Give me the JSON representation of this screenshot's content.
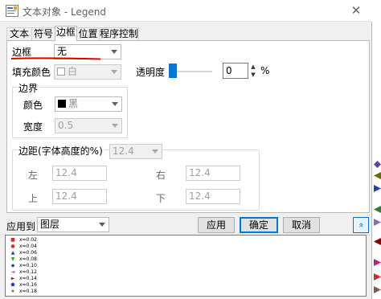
{
  "window": {
    "title": "文本对象 - Legend",
    "close_glyph": "✕"
  },
  "tabs": [
    {
      "label": "文本",
      "active": false
    },
    {
      "label": "符号",
      "active": false
    },
    {
      "label": "边框",
      "active": true
    },
    {
      "label": "位置",
      "active": false
    },
    {
      "label": "程序控制",
      "active": false
    }
  ],
  "border_tab": {
    "border_label": "边框",
    "border_value": "无",
    "fill_label": "填充颜色",
    "fill_value": "白",
    "fill_color": "#ffffff",
    "transparency_label": "透明度",
    "transparency_value": "0",
    "transparency_unit": "%",
    "transparency_level": 0,
    "edge_group": {
      "title": "边界",
      "color_label": "颜色",
      "color_value": "黑",
      "color_swatch": "#000000",
      "width_label": "宽度",
      "width_value": "0.5"
    },
    "margin_group": {
      "title": "边距(字体高度的%)",
      "all_value": "12.4",
      "left_label": "左",
      "left_value": "12.4",
      "right_label": "右",
      "right_value": "12.4",
      "top_label": "上",
      "top_value": "12.4",
      "bottom_label": "下",
      "bottom_value": "12.4"
    }
  },
  "apply_to": {
    "label": "应用到",
    "value": "图层"
  },
  "buttons": {
    "apply": "应用",
    "ok": "确定",
    "cancel": "取消",
    "expand_glyph": "»"
  },
  "preview": {
    "legend_items": [
      {
        "symbol": "■",
        "color": "#d62728",
        "label": "x=0.02"
      },
      {
        "symbol": "●",
        "color": "#d62728",
        "label": "x=0.04"
      },
      {
        "symbol": "▲",
        "color": "#1f3fbf",
        "label": "x=0.06"
      },
      {
        "symbol": "▼",
        "color": "#2ca02c",
        "label": "x=0.08"
      },
      {
        "symbol": "◆",
        "color": "#1f3fbf",
        "label": "x=0.10"
      },
      {
        "symbol": "◄",
        "color": "#9467bd",
        "label": "x=0.12"
      },
      {
        "symbol": "►",
        "color": "#8b0000",
        "label": "x=0.14"
      },
      {
        "symbol": "⬟",
        "color": "#1f3fbf",
        "label": "x=0.16"
      },
      {
        "symbol": "★",
        "color": "#6b6b00",
        "label": "x=0.18"
      }
    ]
  },
  "colors": {
    "accent": "#0078d7",
    "annotation_underline": "#e00000"
  }
}
